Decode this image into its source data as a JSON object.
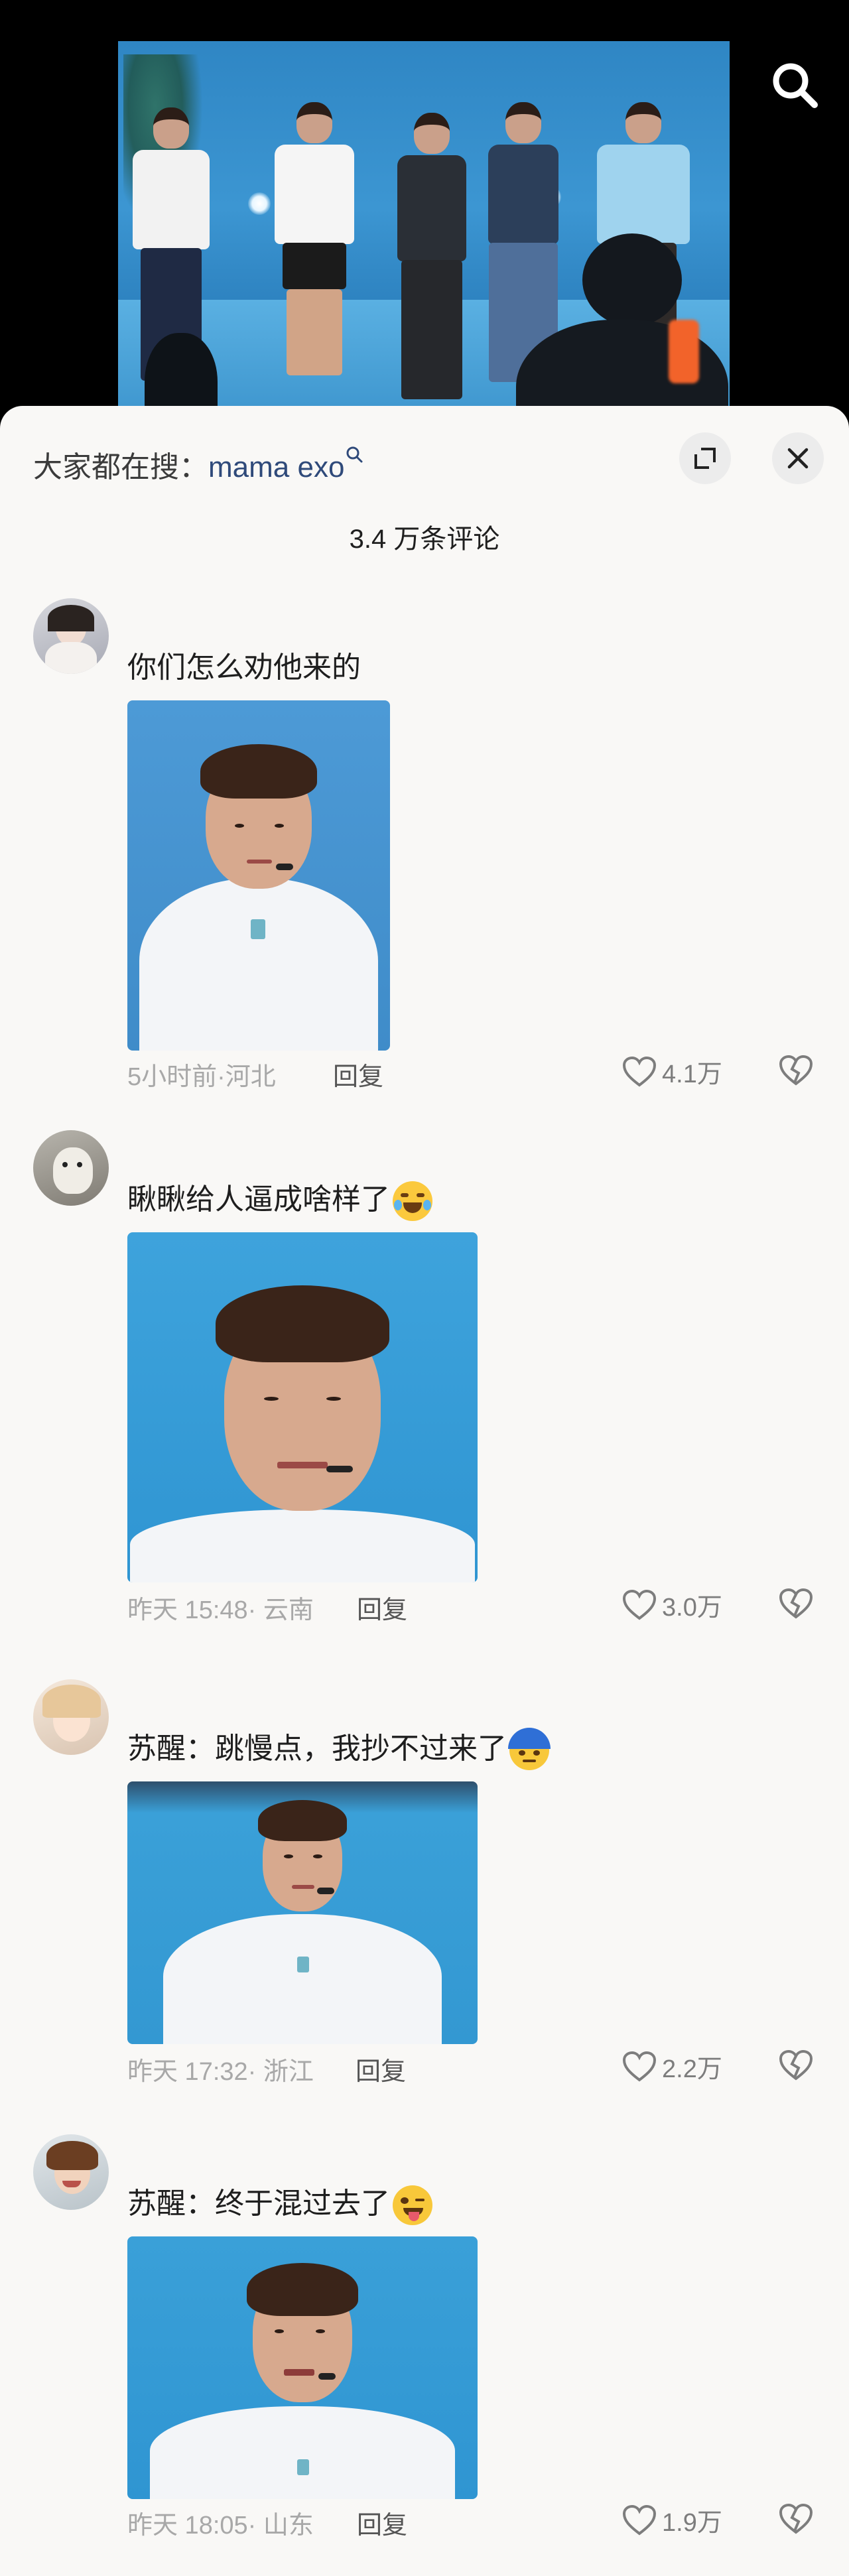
{
  "top_bar": {
    "search_icon": "search-icon"
  },
  "search_hint": {
    "prefix": "大家都在搜：",
    "term": "mama exo"
  },
  "header_buttons": {
    "expand_icon": "expand-icon",
    "close_icon": "close-icon"
  },
  "comment_count": "3.4 万条评论",
  "comments": [
    {
      "text": "你们怎么劝他来的",
      "meta": "5小时前·河北",
      "reply": "回复",
      "likes": "4.1万"
    },
    {
      "text": "瞅瞅给人逼成啥样了",
      "emoji": "crying-laughing-emoji",
      "meta": "昨天 15:48· 云南",
      "reply": "回复",
      "likes": "3.0万"
    },
    {
      "text": "苏醒：跳慢点，我抄不过来了",
      "emoji": "sweating-emoji",
      "meta": "昨天 17:32· 浙江",
      "reply": "回复",
      "likes": "2.2万"
    },
    {
      "text": "苏醒：终于混过去了",
      "emoji": "winking-tongue-emoji",
      "meta": "昨天 18:05· 山东",
      "reply": "回复",
      "likes": "1.9万"
    }
  ],
  "colors": {
    "sheet_bg": "#f9f8f6",
    "search_term": "#2f4a7a",
    "meta_gray": "#a8a8a8"
  }
}
